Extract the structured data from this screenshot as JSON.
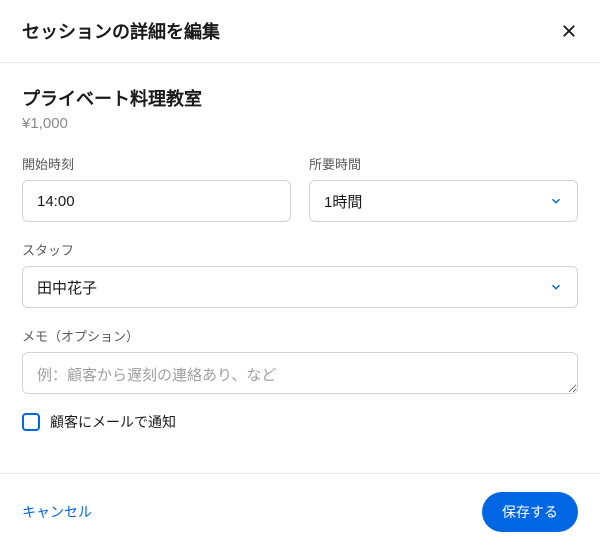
{
  "header": {
    "title": "セッションの詳細を編集"
  },
  "service": {
    "title": "プライベート料理教室",
    "price": "¥1,000"
  },
  "fields": {
    "start_time": {
      "label": "開始時刻",
      "value": "14:00"
    },
    "duration": {
      "label": "所要時間",
      "value": "1時間"
    },
    "staff": {
      "label": "スタッフ",
      "value": "田中花子"
    },
    "memo": {
      "label": "メモ（オプション）",
      "placeholder": "例：顧客から遅刻の連絡あり、など",
      "value": ""
    },
    "notify": {
      "label": "顧客にメールで通知",
      "checked": false
    }
  },
  "footer": {
    "cancel": "キャンセル",
    "save": "保存する"
  }
}
